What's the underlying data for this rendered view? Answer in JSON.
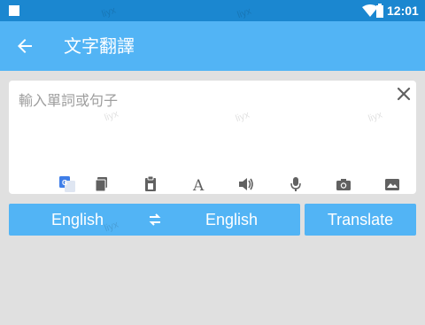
{
  "status_bar": {
    "time": "12:01"
  },
  "app_bar": {
    "title": "文字翻譯"
  },
  "input": {
    "placeholder": "輸入單詞或句子"
  },
  "toolbar_icons": [
    "google-translate-icon",
    "copy-icon",
    "paste-icon",
    "font-size-icon",
    "speaker-icon",
    "microphone-icon",
    "camera-icon",
    "image-icon"
  ],
  "language_bar": {
    "source": "English",
    "target": "English"
  },
  "translate_button": {
    "label": "Translate"
  },
  "watermark": "liyx",
  "colors": {
    "status_bar": "#1b87d0",
    "app_bar": "#52b4f5",
    "accent": "#52b4f5",
    "background": "#e0e0e0"
  }
}
